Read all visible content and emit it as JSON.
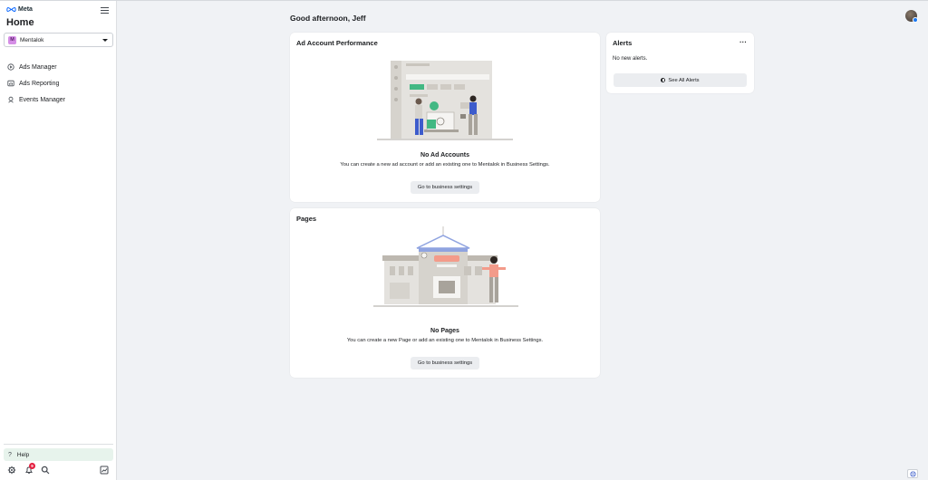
{
  "sidebar": {
    "brand": "Meta",
    "title": "Home",
    "account": {
      "initial": "M",
      "name": "Mentalok"
    },
    "nav": [
      {
        "label": "Ads Manager",
        "icon": "ads-manager-icon"
      },
      {
        "label": "Ads Reporting",
        "icon": "ads-reporting-icon"
      },
      {
        "label": "Events Manager",
        "icon": "events-manager-icon"
      }
    ],
    "help": "Help",
    "notifications_count": "9",
    "bottom_icons": [
      "gear-icon",
      "bell-icon",
      "search-icon",
      "chart-icon"
    ]
  },
  "main": {
    "greeting": "Good afternoon, Jeff",
    "ad_account": {
      "title": "Ad Account Performance",
      "empty_title": "No Ad Accounts",
      "empty_desc": "You can create a new ad account or add an existing one to Mentalok in Business Settings.",
      "button": "Go to business settings"
    },
    "pages": {
      "title": "Pages",
      "empty_title": "No Pages",
      "empty_desc": "You can create a new Page or add an existing one to Mentalok in Business Settings.",
      "button": "Go to business settings"
    },
    "alerts": {
      "title": "Alerts",
      "menu": "···",
      "empty": "No new alerts.",
      "button": "See All Alerts"
    }
  },
  "colors": {
    "accent_green": "#42b883",
    "help_bg": "#e7f3ec",
    "badge_red": "#e41e3f",
    "avatar_purple": "#d58ee6",
    "background": "#f0f2f5"
  }
}
